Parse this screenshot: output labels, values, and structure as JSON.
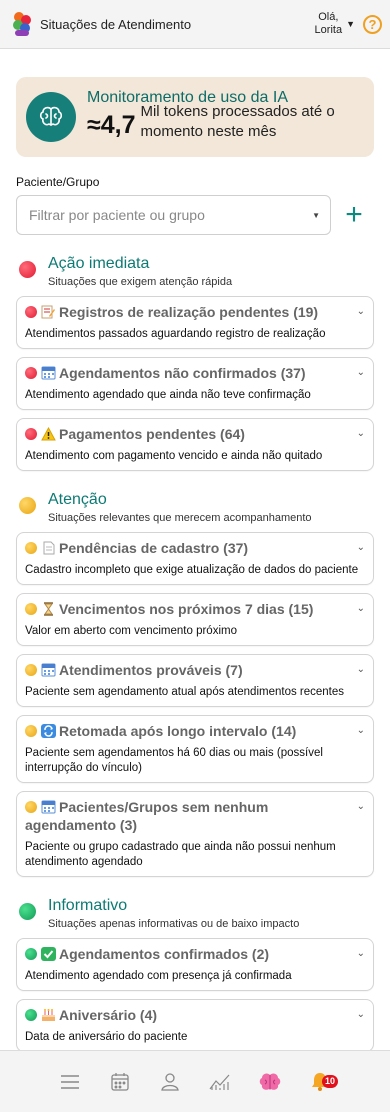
{
  "header": {
    "title": "Situações de Atendimento",
    "greeting": "Olá,",
    "user_name": "Lorita",
    "help_label": "?"
  },
  "ai_card": {
    "title": "Monitoramento de uso da IA",
    "value": "≈4,7",
    "description": "Mil tokens processados até o momento neste mês"
  },
  "filter": {
    "label": "Paciente/Grupo",
    "placeholder": "Filtrar por paciente ou grupo",
    "add_label": "+"
  },
  "sections": [
    {
      "title": "Ação imediata",
      "subtitle": "Situações que exigem atenção rápida",
      "color": "#e01a32",
      "items": [
        {
          "icon": "memo-icon",
          "title": "Registros de realização pendentes (19)",
          "desc": "Atendimentos passados aguardando registro de realização"
        },
        {
          "icon": "calendar-icon",
          "title": "Agendamentos não confirmados (37)",
          "desc": "Atendimento agendado que ainda não teve confirmação"
        },
        {
          "icon": "warning-icon",
          "title": "Pagamentos pendentes (64)",
          "desc": "Atendimento com pagamento vencido e ainda não quitado"
        }
      ]
    },
    {
      "title": "Atenção",
      "subtitle": "Situações relevantes que merecem acompanhamento",
      "color": "#e8a412",
      "items": [
        {
          "icon": "page-icon",
          "title": "Pendências de cadastro (37)",
          "desc": "Cadastro incompleto que exige atualização de dados do paciente"
        },
        {
          "icon": "hourglass-icon",
          "title": "Vencimentos nos próximos 7 dias (15)",
          "desc": "Valor em aberto com vencimento próximo"
        },
        {
          "icon": "calendar-icon",
          "title": "Atendimentos prováveis (7)",
          "desc": "Paciente sem agendamento atual após atendimentos recentes"
        },
        {
          "icon": "repeat-icon",
          "title": "Retomada após longo intervalo (14)",
          "desc": "Paciente sem agendamentos há 60 dias ou mais (possível interrupção do vínculo)"
        },
        {
          "icon": "calendar-icon",
          "title": "Pacientes/Grupos sem nenhum agendamento (3)",
          "desc": "Paciente ou grupo cadastrado que ainda não possui nenhum atendimento agendado"
        }
      ]
    },
    {
      "title": "Informativo",
      "subtitle": "Situações apenas informativas ou de baixo impacto",
      "color": "#109a55",
      "items": [
        {
          "icon": "check-icon",
          "title": "Agendamentos confirmados (2)",
          "desc": "Atendimento agendado com presença já confirmada"
        },
        {
          "icon": "cake-icon",
          "title": "Aniversário (4)",
          "desc": "Data de aniversário do paciente"
        }
      ]
    }
  ],
  "nav": {
    "notification_count": "10"
  }
}
